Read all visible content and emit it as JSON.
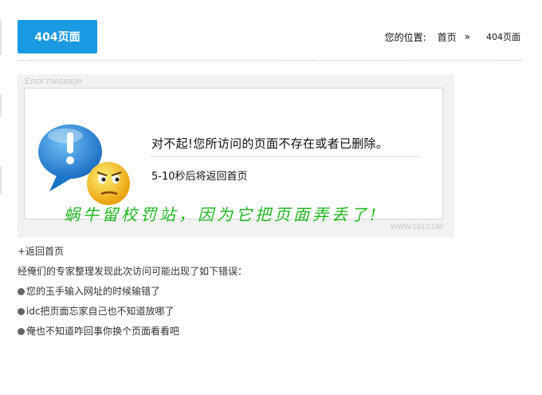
{
  "header": {
    "tab_title": "404页面"
  },
  "breadcrumb": {
    "label": "您的位置:",
    "home": "首页",
    "separator": "»",
    "current": "404页面"
  },
  "error_image": {
    "label": "Error message",
    "message": "对不起!您所访问的页面不存在或者已删除。",
    "redirect": "5-10秒后将返回首页",
    "caption": "蜗牛留校罚站，因为它把页面弄丢了!",
    "watermark": "WWW.163.COM"
  },
  "content": {
    "back_link": "+返回首页",
    "intro": "经俺们的专家整理发现此次访问可能出现了如下错误：",
    "reasons": [
      "您的玉手输入网址的时候输错了",
      "idc把页面忘家自己也不知道放哪了",
      "俺也不知道咋回事你换个页面看看吧"
    ]
  },
  "colors": {
    "accent": "#1a9ae1",
    "caption_green": "#1fb51f",
    "bubble_blue": "#1f86d6",
    "smiley_yellow": "#f5b50a"
  }
}
